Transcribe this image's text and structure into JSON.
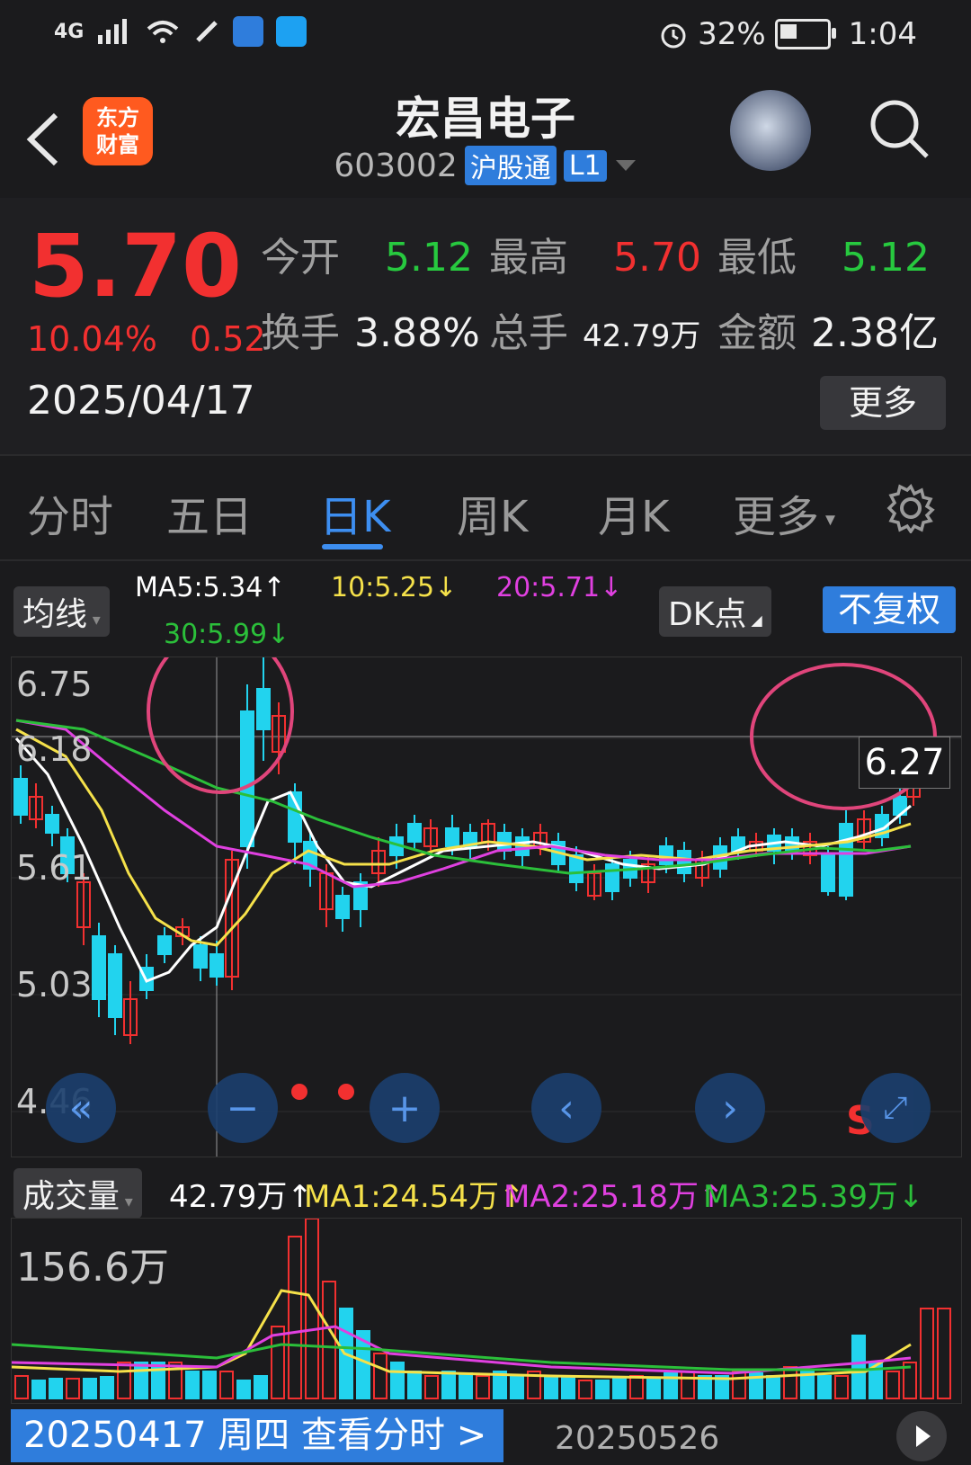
{
  "status": {
    "network": "4G",
    "battery": "32%",
    "time": "1:04"
  },
  "header": {
    "logo_line1": "东方",
    "logo_line2": "财富",
    "title": "宏昌电子",
    "code": "603002",
    "tag1": "沪股通",
    "tag2": "L1"
  },
  "quote": {
    "price": "5.70",
    "change_pct": "10.04%",
    "change": "0.52",
    "date": "2025/04/17",
    "open_label": "今开",
    "open": "5.12",
    "high_label": "最高",
    "high": "5.70",
    "low_label": "最低",
    "low": "5.12",
    "turnover_label": "换手",
    "turnover": "3.88%",
    "volume_label": "总手",
    "volume": "42.79万",
    "amount_label": "金额",
    "amount": "2.38亿",
    "more": "更多"
  },
  "tabs": [
    "分时",
    "五日",
    "日K",
    "周K",
    "月K",
    "更多"
  ],
  "ma": {
    "label": "均线",
    "ma5": "MA5:5.34",
    "ma10": "10:5.25",
    "ma20": "20:5.71",
    "ma30": "30:5.99",
    "dk": "DK点",
    "fq": "不复权"
  },
  "chart": {
    "y_labels": [
      "6.75",
      "6.18",
      "5.61",
      "5.03",
      "4.46"
    ],
    "crosshair_price": "6.27",
    "s_label": "S"
  },
  "volume": {
    "label": "成交量",
    "vol": "42.79万",
    "ma1": "MA1:24.54万",
    "ma2": "MA2:25.18万",
    "ma3": "MA3:25.39万",
    "y_max": "156.6万"
  },
  "bottom": {
    "date_btn": "20250417 周四 查看分时 >",
    "date_end": "20250526"
  },
  "colors": {
    "up": "#f23030",
    "down": "#27c93f",
    "accent": "#3d8ef0",
    "ma5": "#ffffff",
    "ma10": "#f5e14a",
    "ma20": "#e040e0",
    "ma30": "#2bbf3a"
  }
}
